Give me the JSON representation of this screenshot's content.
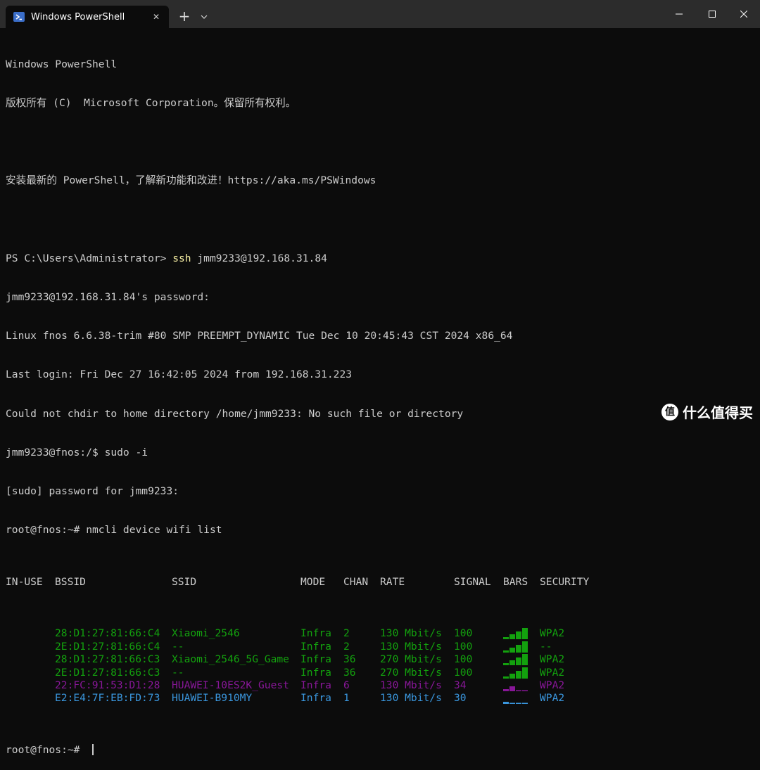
{
  "window": {
    "tab_title": "Windows PowerShell",
    "tab_close": "✕",
    "new_tab": "+"
  },
  "terminal": {
    "header_line1": "Windows PowerShell",
    "header_line2": "版权所有 (C)  Microsoft Corporation。保留所有权利。",
    "header_line3": "安装最新的 PowerShell，了解新功能和改进！https://aka.ms/PSWindows",
    "prompt": "PS C:\\Users\\Administrator> ",
    "ssh_cmd": "ssh",
    "ssh_args": " jmm9233@192.168.31.84",
    "password_prompt": "jmm9233@192.168.31.84's password:",
    "uname": "Linux fnos 6.6.38-trim #80 SMP PREEMPT_DYNAMIC Tue Dec 10 20:45:43 CST 2024 x86_64",
    "last_login": "Last login: Fri Dec 27 16:42:05 2024 from 192.168.31.223",
    "chdir_error": "Could not chdir to home directory /home/jmm9233: No such file or directory",
    "sudo_cmd": "jmm9233@fnos:/$ sudo -i",
    "sudo_prompt": "[sudo] password for jmm9233:",
    "nmcli_cmd": "root@fnos:~# nmcli device wifi list",
    "final_prompt": "root@fnos:~# "
  },
  "wifi_table": {
    "headers": [
      "IN-USE",
      "BSSID",
      "SSID",
      "MODE",
      "CHAN",
      "RATE",
      "SIGNAL",
      "BARS",
      "SECURITY"
    ],
    "rows": [
      {
        "bssid": "28:D1:27:81:66:C4",
        "ssid": "Xiaomi_2546",
        "mode": "Infra",
        "chan": "2",
        "rate": "130 Mbit/s",
        "signal": "100",
        "security": "WPA2",
        "color": "#13a10e",
        "bars": 4
      },
      {
        "bssid": "2E:D1:27:81:66:C4",
        "ssid": "--",
        "mode": "Infra",
        "chan": "2",
        "rate": "130 Mbit/s",
        "signal": "100",
        "security": "--",
        "color": "#13a10e",
        "bars": 4
      },
      {
        "bssid": "28:D1:27:81:66:C3",
        "ssid": "Xiaomi_2546_5G_Game",
        "mode": "Infra",
        "chan": "36",
        "rate": "270 Mbit/s",
        "signal": "100",
        "security": "WPA2",
        "color": "#13a10e",
        "bars": 4
      },
      {
        "bssid": "2E:D1:27:81:66:C3",
        "ssid": "--",
        "mode": "Infra",
        "chan": "36",
        "rate": "270 Mbit/s",
        "signal": "100",
        "security": "WPA2",
        "color": "#13a10e",
        "bars": 4
      },
      {
        "bssid": "22:FC:91:53:D1:28",
        "ssid": "HUAWEI-10ES2K_Guest",
        "mode": "Infra",
        "chan": "6",
        "rate": "130 Mbit/s",
        "signal": "34",
        "security": "WPA2",
        "color": "#881798",
        "bars": 2
      },
      {
        "bssid": "E2:E4:7F:EB:FD:73",
        "ssid": "HUAWEI-B910MY",
        "mode": "Infra",
        "chan": "1",
        "rate": "130 Mbit/s",
        "signal": "30",
        "security": "WPA2",
        "color": "#3a96dd",
        "bars": 1
      }
    ]
  },
  "watermark": {
    "logo_char": "值",
    "text": "什么值得买"
  },
  "colors": {
    "background": "#0c0c0c",
    "titlebar": "#2c2c2c",
    "text": "#cccccc",
    "prompt_cmd": "#f9f1a5"
  }
}
